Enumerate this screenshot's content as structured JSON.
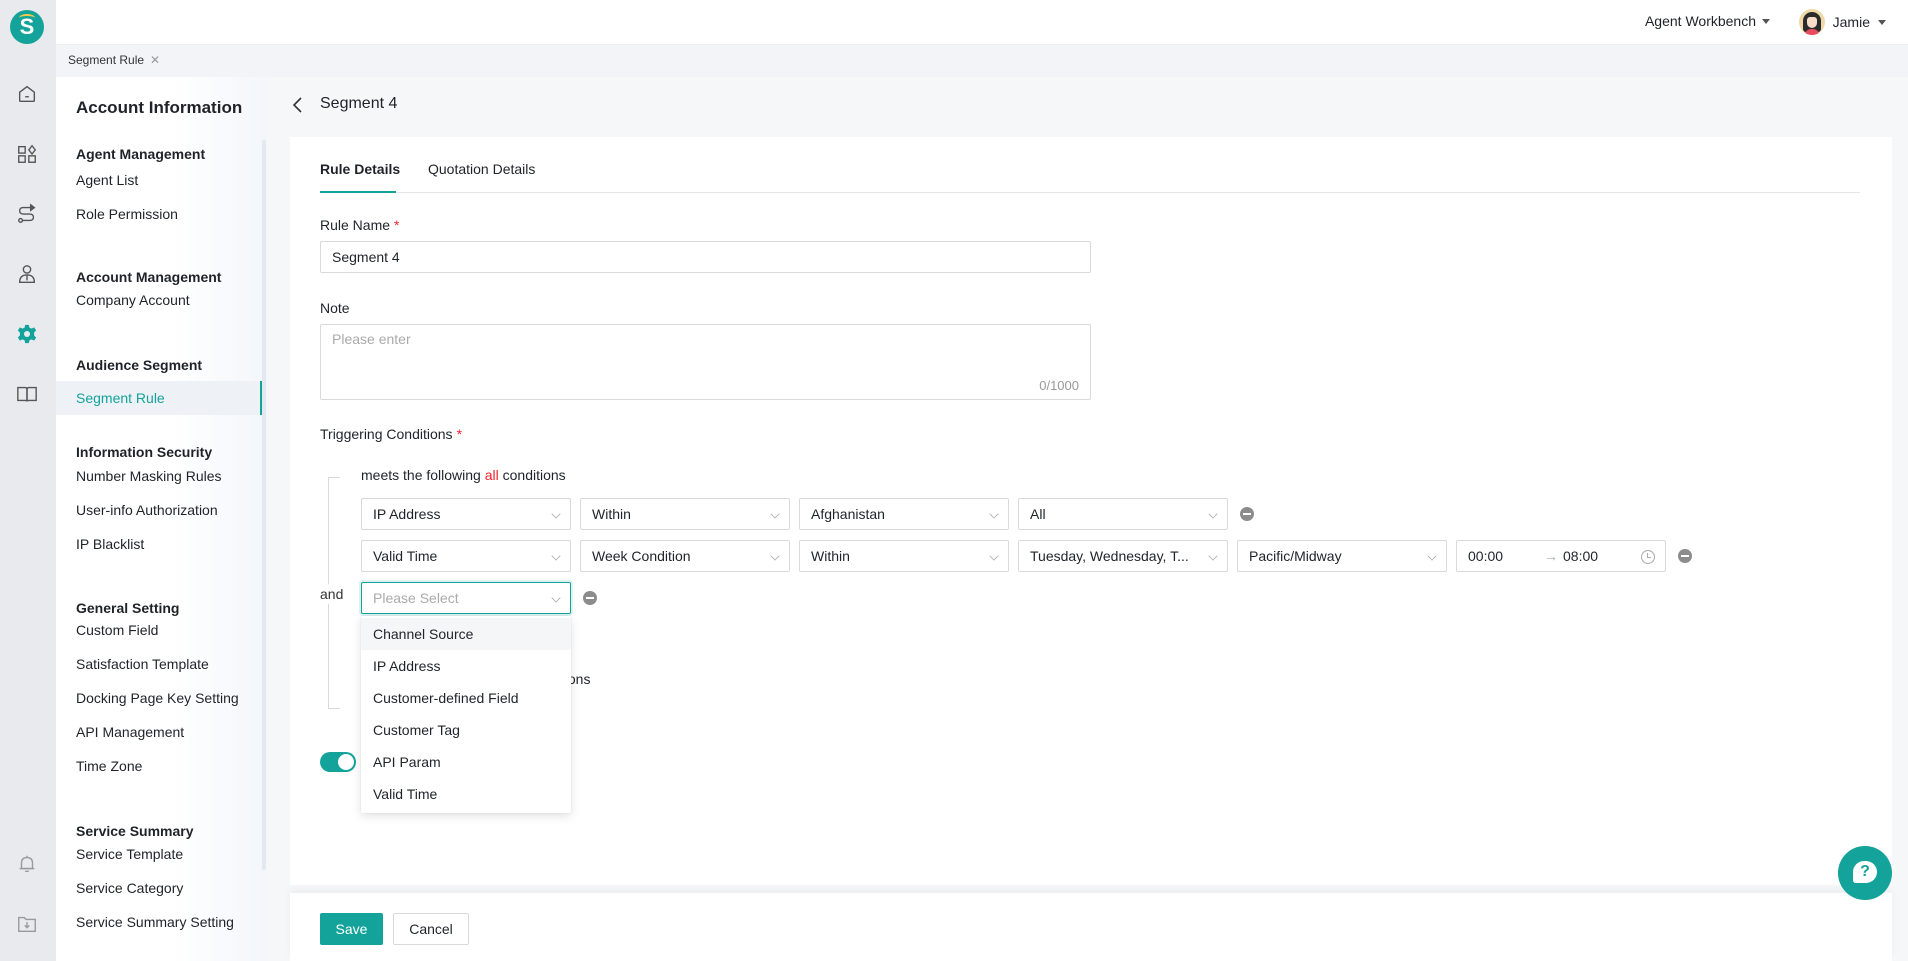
{
  "app": {
    "logo_letter": "S",
    "workbench_label": "Agent Workbench",
    "user_name": "Jamie"
  },
  "rail": {
    "icons": [
      "home-icon",
      "apps-icon",
      "route-icon",
      "agent-icon",
      "settings-icon",
      "book-icon",
      "bell-icon",
      "download-folder-icon"
    ],
    "active": "settings-icon",
    "accent": "#13a39a"
  },
  "open_tabs": [
    {
      "label": "Segment Rule",
      "closable": true
    }
  ],
  "subnav": {
    "title": "Account Information",
    "groups": [
      {
        "label": "Agent Management",
        "items": [
          "Agent List",
          "Role Permission"
        ]
      },
      {
        "label": "Account Management",
        "items": [
          "Company Account"
        ]
      },
      {
        "label": "Audience Segment",
        "items": [
          "Segment Rule"
        ]
      },
      {
        "label": "Information Security",
        "items": [
          "Number Masking Rules",
          "User-info Authorization",
          "IP Blacklist"
        ]
      },
      {
        "label": "General Setting",
        "items": [
          "Custom Field",
          "Satisfaction Template",
          "Docking Page Key Setting",
          "API Management",
          "Time Zone"
        ]
      },
      {
        "label": "Service Summary",
        "items": [
          "Service Template",
          "Service Category",
          "Service Summary Setting"
        ]
      }
    ],
    "active_item": "Segment Rule"
  },
  "page": {
    "title": "Segment 4",
    "tabs": [
      {
        "label": "Rule Details",
        "active": true
      },
      {
        "label": "Quotation Details",
        "active": false
      }
    ]
  },
  "form": {
    "rule_name": {
      "label": "Rule Name",
      "required_mark": "*",
      "value": "Segment 4"
    },
    "note": {
      "label": "Note",
      "placeholder": "Please enter",
      "counter": "0/1000"
    },
    "triggering": {
      "label": "Triggering Conditions",
      "required_mark": "*",
      "joiner": "and",
      "group1": {
        "prefix": "meets the following",
        "highlight": "all",
        "suffix": "conditions",
        "rows": [
          {
            "field": "IP Address",
            "operator": "Within",
            "value": "Afghanistan",
            "extra": "All"
          },
          {
            "field": "Valid Time",
            "operator": "Week Condition",
            "value": "Within",
            "days": "Tuesday, Wednesday, T...",
            "timezone": "Pacific/Midway",
            "time_start": "00:00",
            "time_end": "08:00"
          }
        ],
        "new_row_placeholder": "Please Select"
      },
      "group2_partial_text": "ditions"
    },
    "dropdown_options": [
      "Channel Source",
      "IP Address",
      "Customer-defined Field",
      "Customer Tag",
      "API Param",
      "Valid Time"
    ],
    "dropdown_hover": "Channel Source",
    "toggle_on": true
  },
  "footer": {
    "save_label": "Save",
    "cancel_label": "Cancel"
  },
  "help": {
    "glyph": "?"
  }
}
